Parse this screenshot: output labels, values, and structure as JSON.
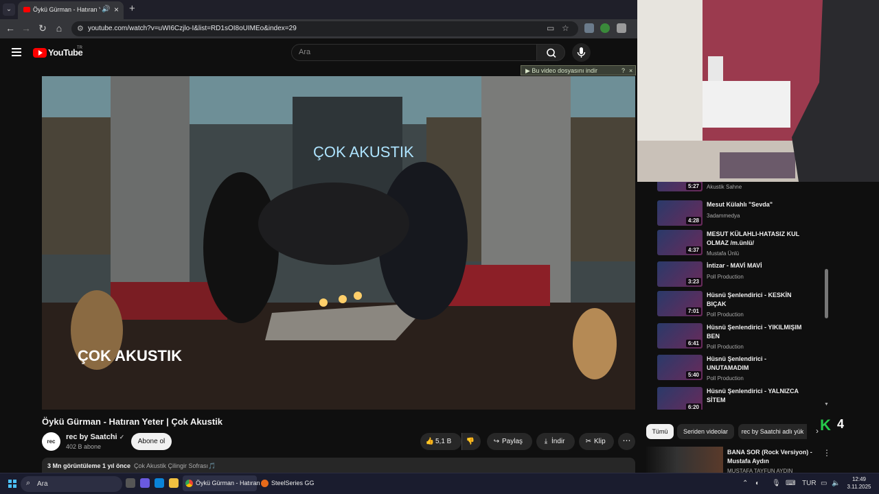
{
  "browser": {
    "tab_title": "Öykü Gürman - Hatıran Yeter | Çok Akustik - YouTube",
    "url": "youtube.com/watch?v=uWI6Czjlo-I&list=RD1sOI8oUIMEo&index=29",
    "download_bar": {
      "label": "Bu video dosyasını indir",
      "help": "?",
      "close": "×"
    }
  },
  "youtube": {
    "logo_text": "YouTube",
    "country_code": "TR",
    "search_placeholder": "Ara"
  },
  "video": {
    "title": "Öykü Gürman - Hatıran Yeter | Çok Akustik",
    "watermark": "ÇOK AKUSTIK",
    "channel": {
      "name": "rec by Saatchi",
      "subscribers": "402 B abone",
      "avatar_text": "rec",
      "verified": "✓"
    },
    "subscribe_label": "Abone ol",
    "actions": {
      "likes": "5,1 B",
      "share": "Paylaş",
      "download": "İndir",
      "clip": "Klip"
    },
    "description": {
      "views_date": "3 Mn görüntüleme  1 yıl önce",
      "tags": "Çok Akustik Çilingir Sofrası🎵"
    }
  },
  "playlist": {
    "items": [
      {
        "title": "",
        "channel": "Akustik Sahne",
        "duration": "5:27"
      },
      {
        "title": "Mesut Külahlı \"Sevda\"",
        "channel": "3adammedya",
        "duration": "4:28"
      },
      {
        "title": "MESUT KÜLAHLI-HATASIZ KUL OLMAZ /m.ünlü/",
        "channel": "Mustafa Ünlü",
        "duration": "4:37"
      },
      {
        "title": "İntizar - MAVİ MAVİ",
        "channel": "Poll Production",
        "duration": "3:23"
      },
      {
        "title": "Hüsnü Şenlendirici - KESKİN BIÇAK",
        "channel": "Poll Production",
        "duration": "7:01"
      },
      {
        "title": "Hüsnü Şenlendirici - YIKILMIŞIM BEN",
        "channel": "Poll Production",
        "duration": "6:41"
      },
      {
        "title": "Hüsnü Şenlendirici - UNUTAMADIM",
        "channel": "Poll Production",
        "duration": "5:40"
      },
      {
        "title": "Hüsnü Şenlendirici - YALNIZCA SİTEM",
        "channel": "",
        "duration": "6:20"
      }
    ]
  },
  "chips": [
    "Tümü",
    "Seriden videolar",
    "rec by Saatchi adlı yük"
  ],
  "overlay": {
    "logo": "K",
    "count": "4"
  },
  "recommended": {
    "title": "BANA SOR (Rock Versiyon) - Mustafa Aydın",
    "channel": "MUSTAFA TAYFUN AYDIN"
  },
  "taskbar": {
    "search_placeholder": "Ara",
    "app1": "Öykü Gürman - Hatıran",
    "app2": "SteelSeries GG",
    "language": "TUR",
    "time": "12:49",
    "date": "3.11.2025"
  },
  "colors": {
    "youtube_red": "#ff0000",
    "background": "#0f0f0f",
    "taskbar": "#1a1c2e",
    "accent_green": "#25c94a"
  }
}
